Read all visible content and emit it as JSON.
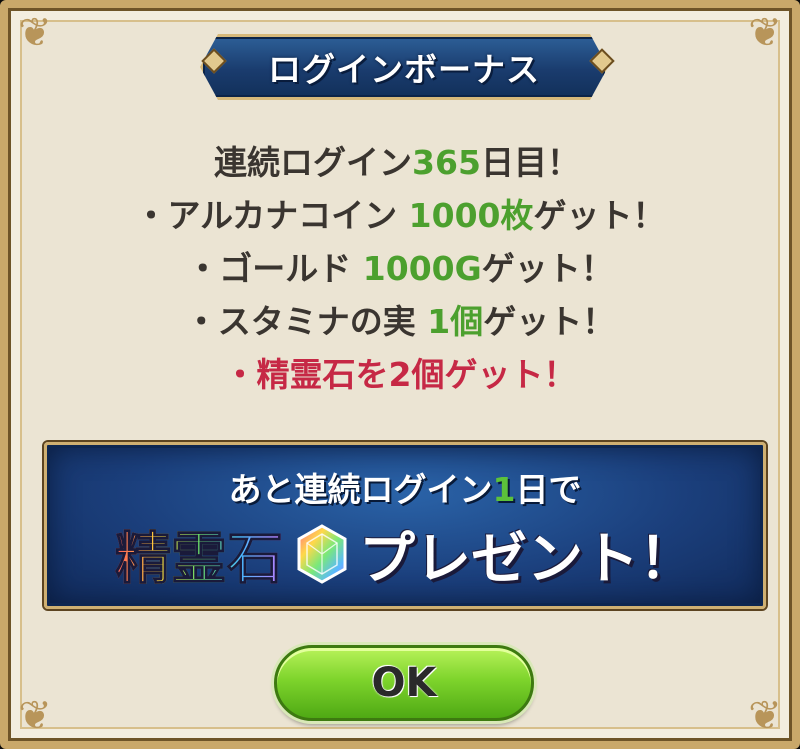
{
  "title": "ログインボーナス",
  "rewards": {
    "line1": {
      "prefix": "連続ログイン",
      "count": "365",
      "suffix": "日目！"
    },
    "line2": {
      "prefix": "・アルカナコイン ",
      "amount": "1000枚",
      "suffix": "ゲット！"
    },
    "line3": {
      "prefix": "・ゴールド ",
      "amount": "1000G",
      "suffix": "ゲット！"
    },
    "line4": {
      "prefix": "・スタミナの実 ",
      "amount": "1個",
      "suffix": "ゲット！"
    },
    "line5": "・精霊石を2個ゲット！"
  },
  "info": {
    "line1_prefix": "あと連続ログイン",
    "line1_days": "1",
    "line1_suffix": "日で",
    "item_name": "精霊石",
    "item_icon": "rainbow-gem-icon",
    "present_text": "プレゼント！"
  },
  "ok_button": "OK",
  "colors": {
    "highlight_green": "#4ca02e",
    "highlight_red": "#c62845",
    "panel_blue": "#1b3f7c",
    "button_green": "#7ed42c"
  }
}
